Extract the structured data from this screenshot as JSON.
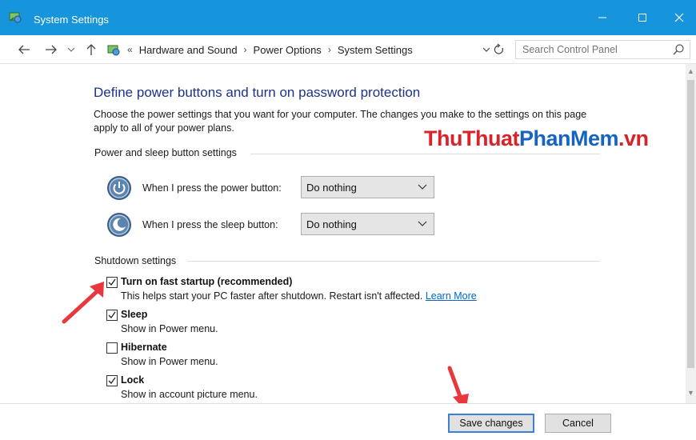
{
  "window": {
    "title": "System Settings",
    "accent_color": "#1795dc"
  },
  "address_bar": {
    "overflow": "«",
    "crumbs": [
      "Hardware and Sound",
      "Power Options",
      "System Settings"
    ],
    "search_placeholder": "Search Control Panel"
  },
  "main": {
    "heading": "Define power buttons and turn on password protection",
    "description": "Choose the power settings that you want for your computer. The changes you make to the settings on this page apply to all of your power plans.",
    "power_group_label": "Power and sleep button settings",
    "power_rows": [
      {
        "label": "When I press the power button:",
        "value": "Do nothing",
        "icon": "power-icon"
      },
      {
        "label": "When I press the sleep button:",
        "value": "Do nothing",
        "icon": "sleep-moon-icon"
      }
    ],
    "shutdown_group_label": "Shutdown settings",
    "shutdown_options": [
      {
        "title": "Turn on fast startup (recommended)",
        "desc": "This helps start your PC faster after shutdown. Restart isn't affected.",
        "link": "Learn More",
        "checked": true
      },
      {
        "title": "Sleep",
        "desc": "Show in Power menu.",
        "checked": true
      },
      {
        "title": "Hibernate",
        "desc": "Show in Power menu.",
        "checked": false
      },
      {
        "title": "Lock",
        "desc": "Show in account picture menu.",
        "checked": true
      }
    ]
  },
  "watermark": {
    "part1": "ThuThuat",
    "part2": "PhanMem",
    "part3": ".vn"
  },
  "footer": {
    "save_label": "Save changes",
    "cancel_label": "Cancel"
  },
  "annotation_color": "#e8383d"
}
